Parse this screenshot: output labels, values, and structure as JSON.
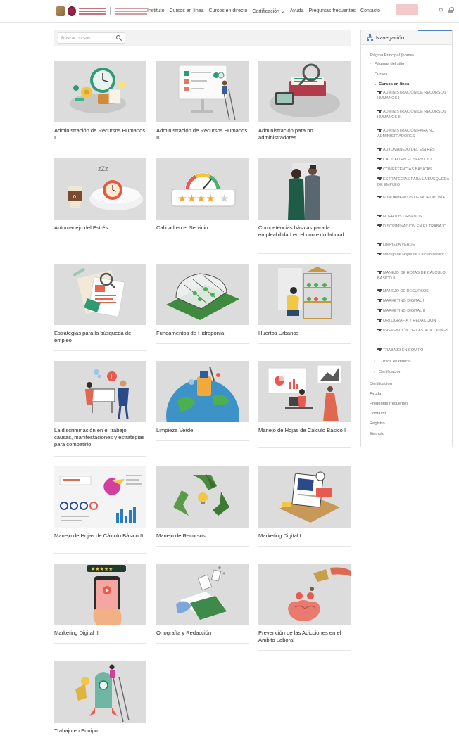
{
  "header": {
    "nav": [
      "Instituto",
      "Cursos en línea",
      "Cursos en directo",
      "Certificación ⌄",
      "Ayuda",
      "Preguntas frecuentes",
      "Contacto"
    ],
    "icons": [
      "search-icon",
      "lock-icon"
    ]
  },
  "search": {
    "placeholder": "Buscar cursos"
  },
  "courses": [
    {
      "title": "Administración de Recursos Humanos I"
    },
    {
      "title": "Administración de Recursos Humanos II"
    },
    {
      "title": "Administración para no administradores"
    },
    {
      "title": "Automanejo del Estrés"
    },
    {
      "title": "Calidad en el Servicio"
    },
    {
      "title": "Competencias básicas para la empleabilidad en el contexto laboral"
    },
    {
      "title": "Estrategias para la búsqueda de empleo"
    },
    {
      "title": "Fundamentos de Hidroponía"
    },
    {
      "title": "Huertos Urbanos"
    },
    {
      "title": "La discriminación en el trabajo: causas, manifestaciones y estrategias para combatirlo"
    },
    {
      "title": "Limpieza Verde"
    },
    {
      "title": "Manejo de Hojas de Cálculo Básico I"
    },
    {
      "title": "Manejo de Hojas de Cálculo Básico II"
    },
    {
      "title": "Manejo de Recursos"
    },
    {
      "title": "Marketing Digital I"
    },
    {
      "title": "Marketing Digital II"
    },
    {
      "title": "Ortografía y Redacción"
    },
    {
      "title": "Prevención de las Adicciones en el Ámbito Laboral"
    },
    {
      "title": "Trabajo en Equipo"
    }
  ],
  "sidebar": {
    "title": "Navegación",
    "tree": [
      {
        "label": "Página Principal (home)",
        "caret": "⌄"
      },
      {
        "label": "Páginas del sitio",
        "caret": "›"
      },
      {
        "label": "Cursos",
        "caret": "⌄"
      },
      {
        "label": "Cursos en línea",
        "caret": "⌄"
      }
    ],
    "courses": [
      "ADMINISTRACIÓN DE RECURSOS HUMANOS I",
      "ADMINISTRACIÓN DE RECURSOS HUMANOS II",
      "ADMINISTRACIÓN PARA NO ADMINISTRADORES",
      "AUTOMANEJO DEL ESTRÉS",
      "CALIDAD EN EL SERVICIO",
      "COMPETENCIAS BÁSICAS",
      "ESTRATEGIAS PARA LA BÚSQUEDA DE EMPLEO",
      "FUNDAMENTOS DE HIDROPONÍA",
      "HUERTOS URBANOS",
      "DISCRIMINACIÓN EN EL TRABAJO",
      "LIMPIEZA VERDE",
      "Manejo de Hojas de Cálculo Básico I",
      "MANEJO DE HOJAS DE CÁLCULO BÁSICO II",
      "MANEJO DE RECURSOS",
      "MARKETING DIGITAL I",
      "MARKETING DIGITAL II",
      "ORTOGRAFÍA Y REDACCIÓN",
      "PREVENCIÓN DE LAS ADICCIONES",
      "TRABAJO EN EQUIPO"
    ],
    "after": [
      {
        "label": "Cursos en directo",
        "caret": "›"
      },
      {
        "label": "Certificación",
        "caret": "›"
      }
    ],
    "links": [
      "Certificación",
      "Ayuda",
      "Preguntas frecuentes",
      "Contacto",
      "Registro",
      "Ejemplo"
    ]
  }
}
